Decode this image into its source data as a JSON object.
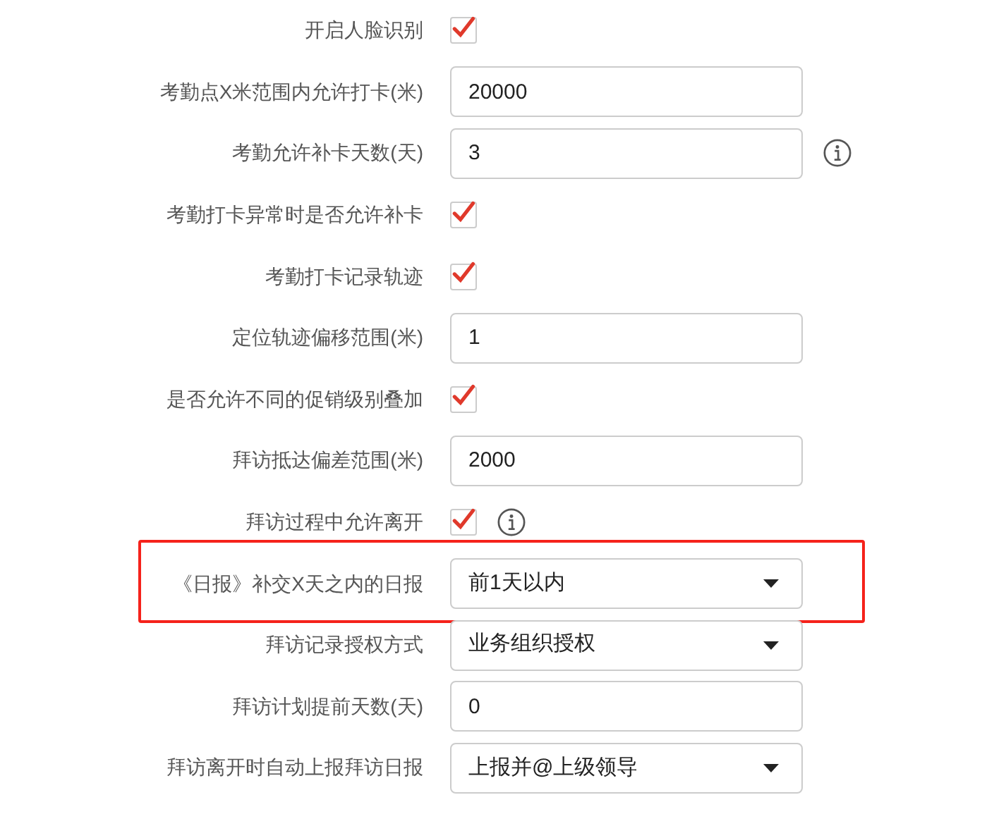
{
  "settings": [
    {
      "kind": "checkbox",
      "label": "开启人脸识别",
      "checked": true,
      "info": false,
      "highlighted": false
    },
    {
      "kind": "input",
      "label": "考勤点X米范围内允许打卡(米)",
      "value": "20000",
      "info": false,
      "highlighted": false
    },
    {
      "kind": "input",
      "label": "考勤允许补卡天数(天)",
      "value": "3",
      "info": true,
      "highlighted": false
    },
    {
      "kind": "checkbox",
      "label": "考勤打卡异常时是否允许补卡",
      "checked": true,
      "info": false,
      "highlighted": false
    },
    {
      "kind": "checkbox",
      "label": "考勤打卡记录轨迹",
      "checked": true,
      "info": false,
      "highlighted": false
    },
    {
      "kind": "input",
      "label": "定位轨迹偏移范围(米)",
      "value": "1",
      "info": false,
      "highlighted": false
    },
    {
      "kind": "checkbox",
      "label": "是否允许不同的促销级别叠加",
      "checked": true,
      "info": false,
      "highlighted": false
    },
    {
      "kind": "input",
      "label": "拜访抵达偏差范围(米)",
      "value": "2000",
      "info": false,
      "highlighted": false
    },
    {
      "kind": "checkbox",
      "label": "拜访过程中允许离开",
      "checked": true,
      "info": true,
      "highlighted": false
    },
    {
      "kind": "select",
      "label": "《日报》补交X天之内的日报",
      "value": "前1天以内",
      "info": false,
      "highlighted": true
    },
    {
      "kind": "select",
      "label": "拜访记录授权方式",
      "value": "业务组织授权",
      "info": false,
      "highlighted": false
    },
    {
      "kind": "input",
      "label": "拜访计划提前天数(天)",
      "value": "0",
      "info": false,
      "highlighted": false
    },
    {
      "kind": "select",
      "label": "拜访离开时自动上报拜访日报",
      "value": "上报并@上级领导",
      "info": false,
      "highlighted": false
    }
  ]
}
